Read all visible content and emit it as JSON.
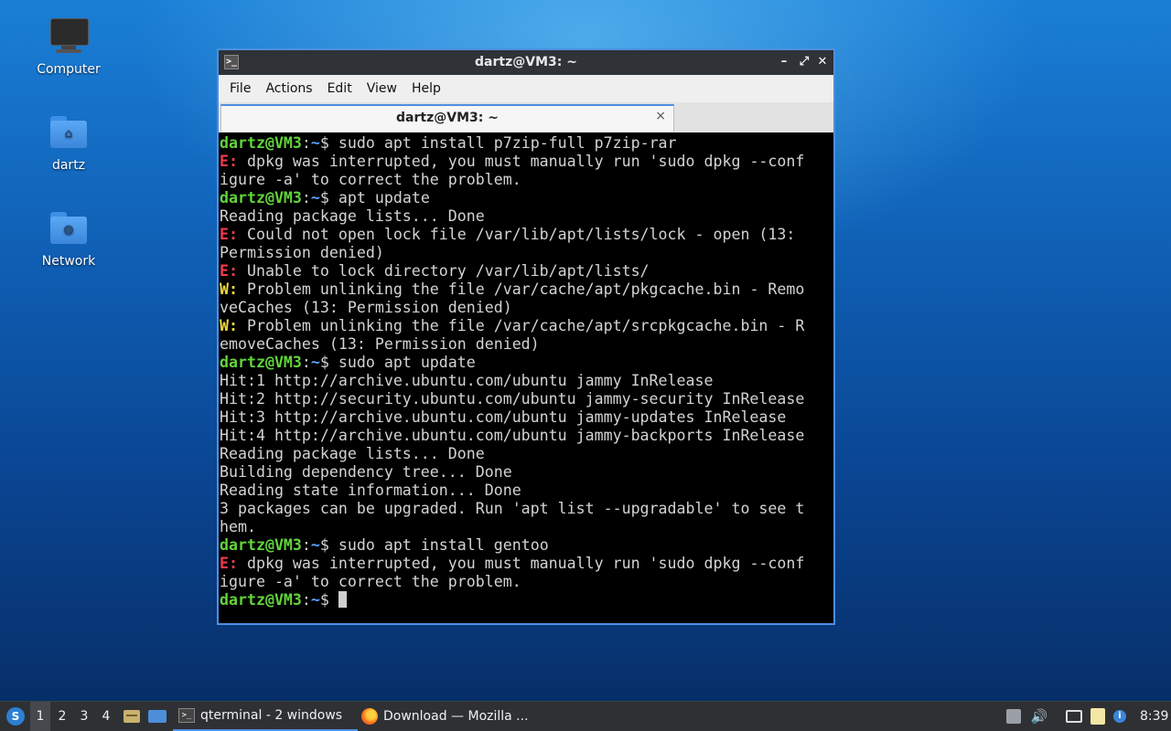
{
  "desktop": {
    "icons": [
      {
        "label": "Computer"
      },
      {
        "label": "dartz"
      },
      {
        "label": "Network"
      }
    ]
  },
  "window": {
    "title": "dartz@VM3: ~",
    "icon_glyph": ">_",
    "controls": {
      "minimize": "–",
      "maximize": "⤢",
      "close": "✕"
    },
    "menu": [
      "File",
      "Actions",
      "Edit",
      "View",
      "Help"
    ],
    "tab": {
      "label": "dartz@VM3: ~",
      "close": "×"
    }
  },
  "terminal": {
    "prompt_user": "dartz@VM3",
    "prompt_path": "~",
    "lines": [
      {
        "type": "prompt",
        "text": "sudo apt install p7zip-full p7zip-rar"
      },
      {
        "type": "error",
        "tag": "E:",
        "text": " dpkg was interrupted, you must manually run 'sudo dpkg --conf"
      },
      {
        "type": "plain",
        "text": "igure -a' to correct the problem."
      },
      {
        "type": "prompt",
        "text": "apt update"
      },
      {
        "type": "plain",
        "text": "Reading package lists... Done"
      },
      {
        "type": "error",
        "tag": "E:",
        "text": " Could not open lock file /var/lib/apt/lists/lock - open (13:"
      },
      {
        "type": "plain",
        "text": "Permission denied)"
      },
      {
        "type": "error",
        "tag": "E:",
        "text": " Unable to lock directory /var/lib/apt/lists/"
      },
      {
        "type": "warn",
        "tag": "W:",
        "text": " Problem unlinking the file /var/cache/apt/pkgcache.bin - Remo"
      },
      {
        "type": "plain",
        "text": "veCaches (13: Permission denied)"
      },
      {
        "type": "warn",
        "tag": "W:",
        "text": " Problem unlinking the file /var/cache/apt/srcpkgcache.bin - R"
      },
      {
        "type": "plain",
        "text": "emoveCaches (13: Permission denied)"
      },
      {
        "type": "prompt",
        "text": "sudo apt update"
      },
      {
        "type": "plain",
        "text": "Hit:1 http://archive.ubuntu.com/ubuntu jammy InRelease"
      },
      {
        "type": "plain",
        "text": "Hit:2 http://security.ubuntu.com/ubuntu jammy-security InRelease"
      },
      {
        "type": "plain",
        "text": "Hit:3 http://archive.ubuntu.com/ubuntu jammy-updates InRelease"
      },
      {
        "type": "plain",
        "text": "Hit:4 http://archive.ubuntu.com/ubuntu jammy-backports InRelease"
      },
      {
        "type": "plain",
        "text": "Reading package lists... Done"
      },
      {
        "type": "plain",
        "text": "Building dependency tree... Done"
      },
      {
        "type": "plain",
        "text": "Reading state information... Done"
      },
      {
        "type": "plain",
        "text": "3 packages can be upgraded. Run 'apt list --upgradable' to see t"
      },
      {
        "type": "plain",
        "text": "hem."
      },
      {
        "type": "prompt",
        "text": "sudo apt install gentoo"
      },
      {
        "type": "error",
        "tag": "E:",
        "text": " dpkg was interrupted, you must manually run 'sudo dpkg --conf"
      },
      {
        "type": "plain",
        "text": "igure -a' to correct the problem."
      },
      {
        "type": "prompt",
        "text": "",
        "cursor": true
      }
    ]
  },
  "taskbar": {
    "start_glyph": "S",
    "desktops": [
      "1",
      "2",
      "3",
      "4"
    ],
    "tasks": [
      {
        "label": "qterminal - 2 windows",
        "icon_glyph": ">_"
      },
      {
        "label": "Download — Mozilla ..."
      }
    ],
    "clock": "8:39",
    "info_glyph": "i",
    "speaker_glyph": "🔊"
  }
}
